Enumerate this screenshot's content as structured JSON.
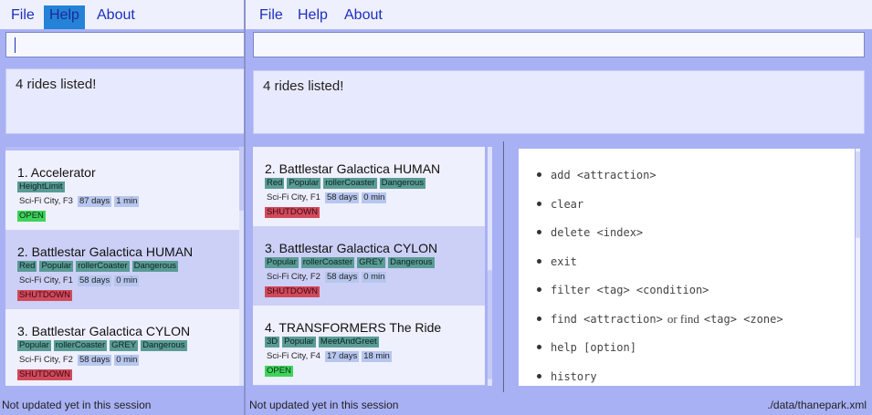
{
  "menu": {
    "file": "File",
    "help": "Help",
    "about": "About"
  },
  "result_text": "4 rides listed!",
  "status_left": "Not updated yet in this session",
  "status_path": "./data/thanepark.xml",
  "cards_left": [
    {
      "name": "1.  Accelerator",
      "tags": [
        "HeightLimit"
      ],
      "zone": "Sci-Fi City, F3",
      "days": "87 days",
      "wait": "1 min",
      "status": "OPEN",
      "status_class": "open"
    },
    {
      "name": "2.  Battlestar Galactica HUMAN",
      "tags": [
        "Red",
        "Popular",
        "rollerCoaster",
        "Dangerous"
      ],
      "zone": "Sci-Fi City, F1",
      "days": "58 days",
      "wait": "0 min",
      "status": "SHUTDOWN",
      "status_class": "shutdown"
    },
    {
      "name": "3.  Battlestar Galactica CYLON",
      "tags": [
        "Popular",
        "rollerCoaster",
        "GREY",
        "Dangerous"
      ],
      "zone": "Sci-Fi City, F2",
      "days": "58 days",
      "wait": "0 min",
      "status": "SHUTDOWN",
      "status_class": "shutdown"
    }
  ],
  "cards_right": [
    {
      "name": "2.  Battlestar Galactica HUMAN",
      "tags": [
        "Red",
        "Popular",
        "rollerCoaster",
        "Dangerous"
      ],
      "zone": "Sci-Fi City, F1",
      "days": "58 days",
      "wait": "0 min",
      "status": "SHUTDOWN",
      "status_class": "shutdown"
    },
    {
      "name": "3.  Battlestar Galactica CYLON",
      "tags": [
        "Popular",
        "rollerCoaster",
        "GREY",
        "Dangerous"
      ],
      "zone": "Sci-Fi City, F2",
      "days": "58 days",
      "wait": "0 min",
      "status": "SHUTDOWN",
      "status_class": "shutdown"
    },
    {
      "name": "4.  TRANSFORMERS The Ride",
      "tags": [
        "3D",
        "Popular",
        "MeetAndGreet"
      ],
      "zone": "Sci-Fi City, F4",
      "days": "17 days",
      "wait": "18 min",
      "status": "OPEN",
      "status_class": "open"
    }
  ],
  "help_items": [
    {
      "code": "add <attraction>"
    },
    {
      "code": "clear"
    },
    {
      "code": "delete <index>"
    },
    {
      "code": "exit"
    },
    {
      "code": "filter <tag> <condition>"
    },
    {
      "code": "find <attraction>",
      "mid": "or find",
      "code2": "<tag> <zone>"
    },
    {
      "code": "help [option]"
    },
    {
      "code": "history"
    }
  ]
}
